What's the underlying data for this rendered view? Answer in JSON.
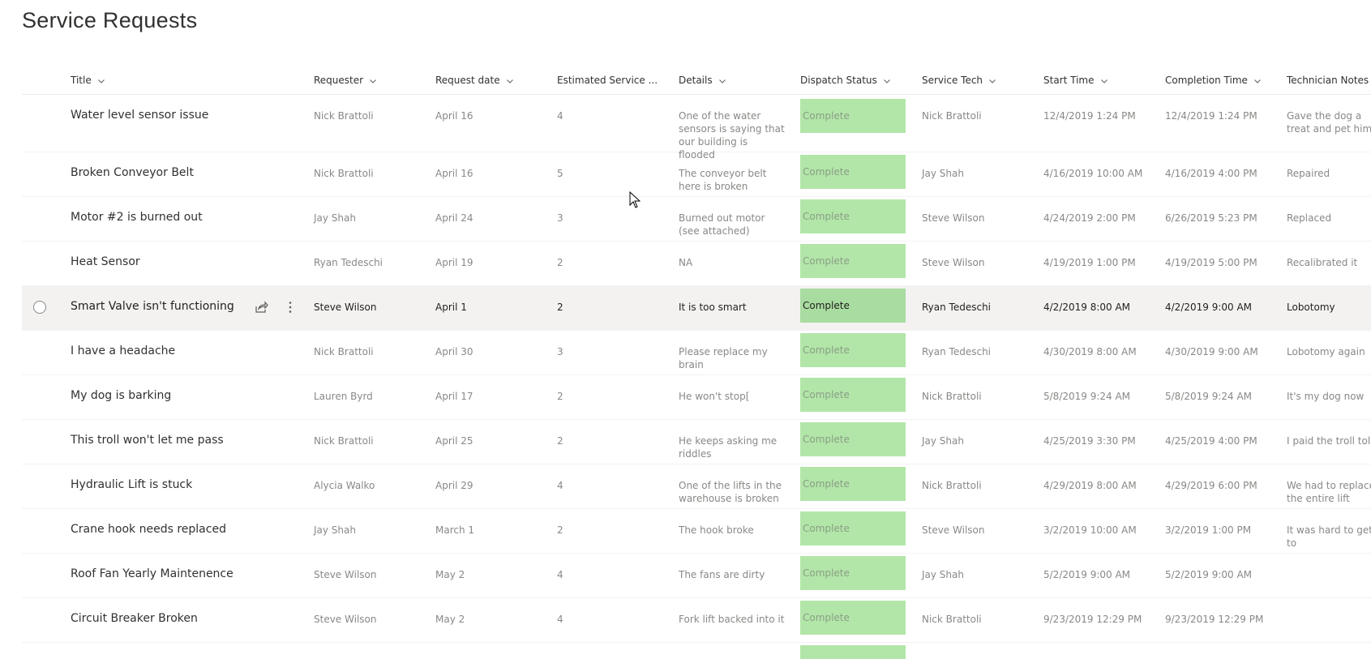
{
  "page": {
    "title": "Service Requests"
  },
  "columns": [
    {
      "key": "title",
      "label": "Title"
    },
    {
      "key": "requester",
      "label": "Requester"
    },
    {
      "key": "request_date",
      "label": "Request date"
    },
    {
      "key": "estimated",
      "label": "Estimated Service ..."
    },
    {
      "key": "details",
      "label": "Details"
    },
    {
      "key": "dispatch",
      "label": "Dispatch Status"
    },
    {
      "key": "tech",
      "label": "Service Tech"
    },
    {
      "key": "start",
      "label": "Start Time"
    },
    {
      "key": "completion",
      "label": "Completion Time"
    },
    {
      "key": "notes",
      "label": "Technician Notes"
    }
  ],
  "rows": [
    {
      "title": "Water level sensor issue",
      "requester": "Nick Brattoli",
      "request_date": "April 16",
      "estimated": "4",
      "details": "One of the water sensors is saying that our building is flooded",
      "dispatch": "Complete",
      "tech": "Nick Brattoli",
      "start": "12/4/2019 1:24 PM",
      "completion": "12/4/2019 1:24 PM",
      "notes": "Gave the dog a treat and pet him"
    },
    {
      "title": "Broken Conveyor Belt",
      "requester": "Nick Brattoli",
      "request_date": "April 16",
      "estimated": "5",
      "details": "The conveyor belt here is broken",
      "dispatch": "Complete",
      "tech": "Jay Shah",
      "start": "4/16/2019 10:00 AM",
      "completion": "4/16/2019 4:00 PM",
      "notes": "Repaired"
    },
    {
      "title": "Motor #2 is burned out",
      "requester": "Jay Shah",
      "request_date": "April 24",
      "estimated": "3",
      "details": "Burned out motor (see attached)",
      "dispatch": "Complete",
      "tech": "Steve Wilson",
      "start": "4/24/2019 2:00 PM",
      "completion": "6/26/2019 5:23 PM",
      "notes": "Replaced"
    },
    {
      "title": "Heat Sensor",
      "requester": "Ryan Tedeschi",
      "request_date": "April 19",
      "estimated": "2",
      "details": "NA",
      "dispatch": "Complete",
      "tech": "Steve Wilson",
      "start": "4/19/2019 1:00 PM",
      "completion": "4/19/2019 5:00 PM",
      "notes": "Recalibrated it"
    },
    {
      "title": "Smart Valve isn't functioning",
      "requester": "Steve Wilson",
      "request_date": "April 1",
      "estimated": "2",
      "details": "It is too smart",
      "dispatch": "Complete",
      "tech": "Ryan Tedeschi",
      "start": "4/2/2019 8:00 AM",
      "completion": "4/2/2019 9:00 AM",
      "notes": "Lobotomy"
    },
    {
      "title": "I have a headache",
      "requester": "Nick Brattoli",
      "request_date": "April 30",
      "estimated": "3",
      "details": "Please replace my brain",
      "dispatch": "Complete",
      "tech": "Ryan Tedeschi",
      "start": "4/30/2019 8:00 AM",
      "completion": "4/30/2019 9:00 AM",
      "notes": "Lobotomy again"
    },
    {
      "title": "My dog is barking",
      "requester": "Lauren Byrd",
      "request_date": "April 17",
      "estimated": "2",
      "details": "He won't stop[",
      "dispatch": "Complete",
      "tech": "Nick Brattoli",
      "start": "5/8/2019 9:24 AM",
      "completion": "5/8/2019 9:24 AM",
      "notes": "It's my dog now"
    },
    {
      "title": "This troll won't let me pass",
      "requester": "Nick Brattoli",
      "request_date": "April 25",
      "estimated": "2",
      "details": "He keeps asking me riddles",
      "dispatch": "Complete",
      "tech": "Jay Shah",
      "start": "4/25/2019 3:30 PM",
      "completion": "4/25/2019 4:00 PM",
      "notes": "I paid the troll toll"
    },
    {
      "title": "Hydraulic Lift is stuck",
      "requester": "Alycia Walko",
      "request_date": "April 29",
      "estimated": "4",
      "details": "One of the lifts in the warehouse is broken",
      "dispatch": "Complete",
      "tech": "Nick Brattoli",
      "start": "4/29/2019 8:00 AM",
      "completion": "4/29/2019 6:00 PM",
      "notes": "We had to replace the entire lift"
    },
    {
      "title": "Crane hook needs replaced",
      "requester": "Jay Shah",
      "request_date": "March 1",
      "estimated": "2",
      "details": "The hook broke",
      "dispatch": "Complete",
      "tech": "Steve Wilson",
      "start": "3/2/2019 10:00 AM",
      "completion": "3/2/2019 1:00 PM",
      "notes": "It was hard to get to"
    },
    {
      "title": "Roof Fan Yearly Maintenence",
      "requester": "Steve Wilson",
      "request_date": "May 2",
      "estimated": "4",
      "details": "The fans are dirty",
      "dispatch": "Complete",
      "tech": "Jay Shah",
      "start": "5/2/2019 9:00 AM",
      "completion": "5/2/2019 9:00 AM",
      "notes": ""
    },
    {
      "title": "Circuit Breaker Broken",
      "requester": "Steve Wilson",
      "request_date": "May 2",
      "estimated": "4",
      "details": "Fork lift backed into it",
      "dispatch": "Complete",
      "tech": "Nick Brattoli",
      "start": "9/23/2019 12:29 PM",
      "completion": "9/23/2019 12:29 PM",
      "notes": ""
    }
  ],
  "hover_row_index": 4,
  "icons": {
    "row_select": "circle-check-icon",
    "share": "share-icon",
    "more": "more-vertical-icon",
    "sort": "chevron-down-icon",
    "cursor": "mouse-pointer-icon"
  },
  "colors": {
    "status_complete_bg": "#b2e6a8",
    "row_hover_bg": "#f3f2f1",
    "text_primary": "#323130",
    "text_secondary": "#8a8886"
  }
}
